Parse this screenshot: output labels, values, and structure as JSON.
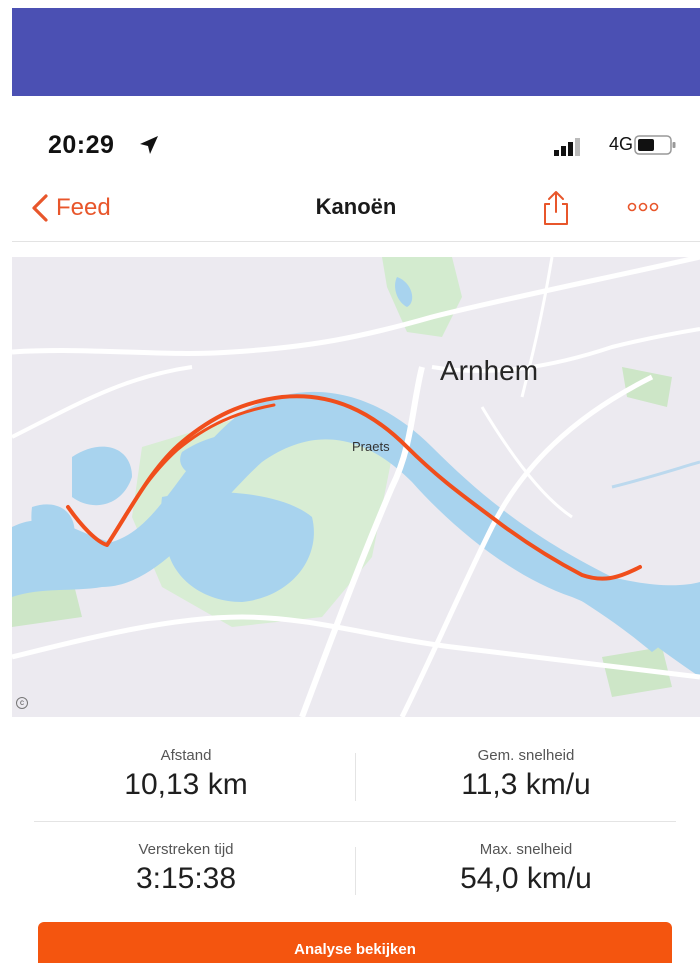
{
  "status_bar": {
    "time": "20:29",
    "network": "4G"
  },
  "nav": {
    "back_label": "Feed",
    "title": "Kanoën"
  },
  "map": {
    "city_label": "Arnhem",
    "place_label": "Praets",
    "route_color": "#f04e1c",
    "water_color": "#a8d3ee",
    "park_color": "#d3ebcf"
  },
  "stats": {
    "distance": {
      "label": "Afstand",
      "value": "10,13 km"
    },
    "avg_speed": {
      "label": "Gem. snelheid",
      "value": "11,3 km/u"
    },
    "elapsed_time": {
      "label": "Verstreken tijd",
      "value": "3:15:38"
    },
    "max_speed": {
      "label": "Max. snelheid",
      "value": "54,0 km/u"
    }
  },
  "actions": {
    "analyse_label": "Analyse bekijken"
  },
  "colors": {
    "accent": "#f4550f",
    "banner": "#4b50b3"
  },
  "icons": {
    "location": "location-arrow-icon",
    "signal": "signal-bars-icon",
    "battery": "battery-icon",
    "back": "chevron-left-icon",
    "share": "share-icon",
    "more": "more-dots-icon"
  }
}
